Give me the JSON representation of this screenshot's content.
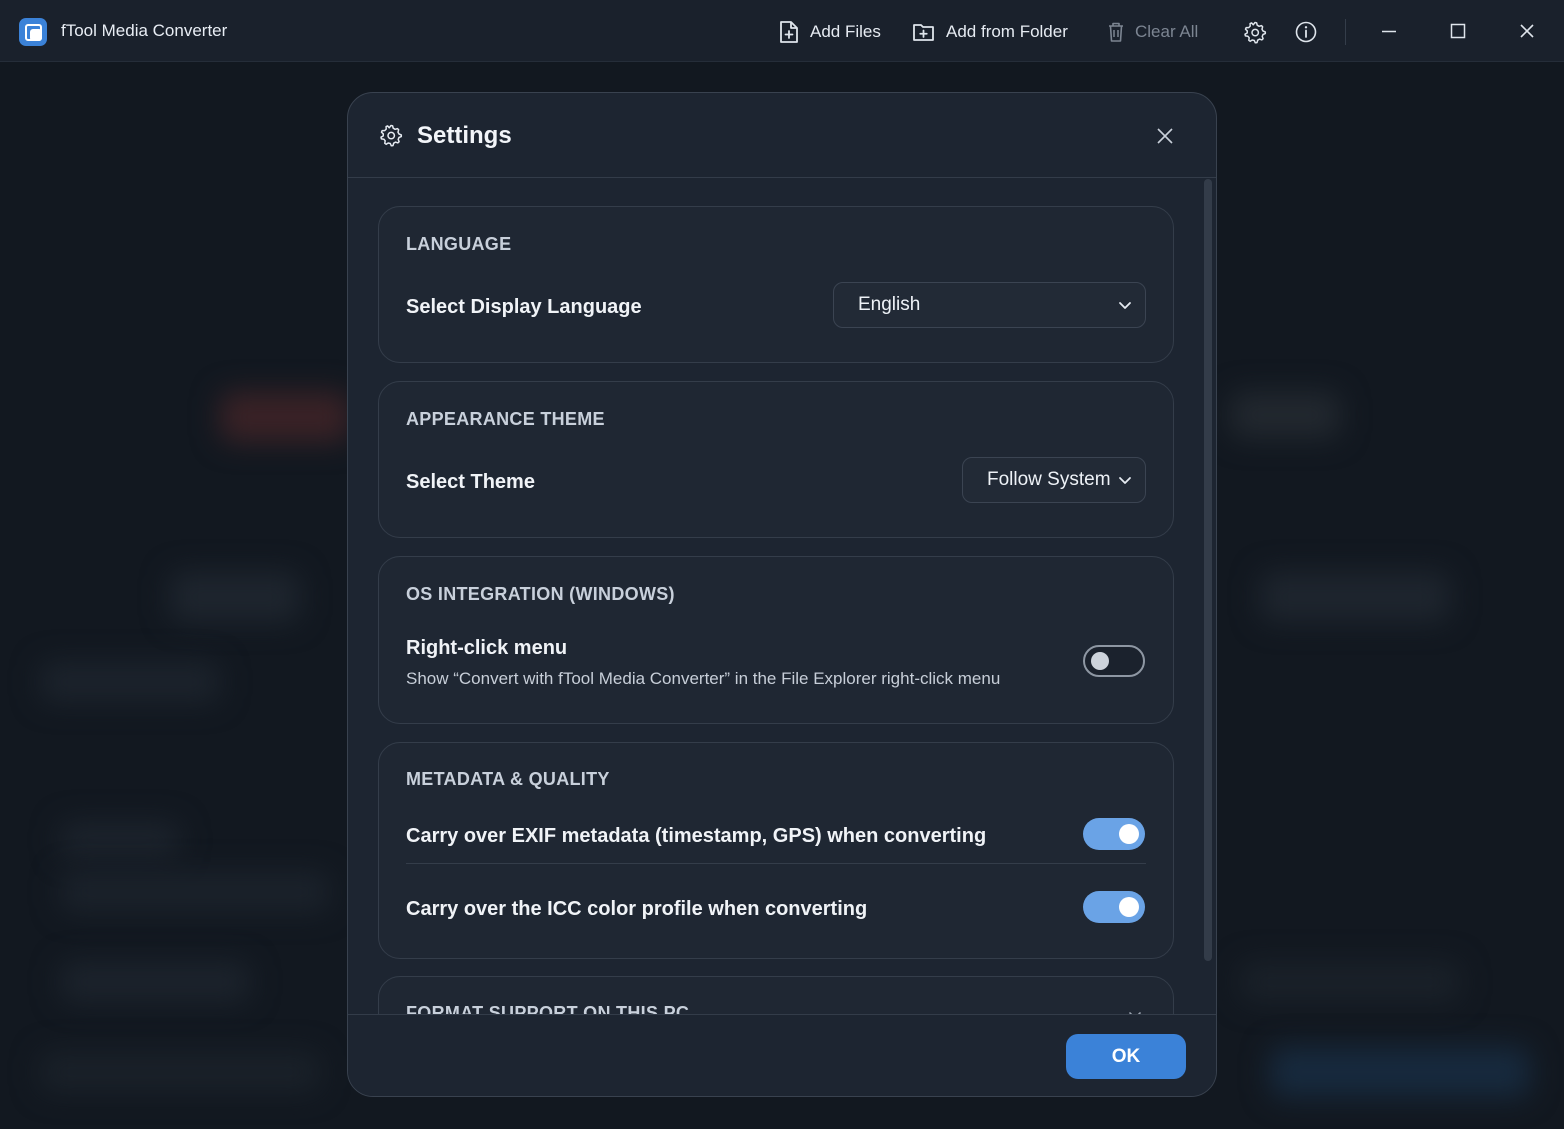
{
  "app": {
    "title": "fTool Media Converter"
  },
  "toolbar": {
    "add_files": "Add Files",
    "add_from_folder": "Add from Folder",
    "clear_all": "Clear All"
  },
  "dialog": {
    "title": "Settings",
    "sections": {
      "language": {
        "title": "LANGUAGE",
        "label": "Select Display Language",
        "value": "English"
      },
      "appearance": {
        "title": "APPEARANCE THEME",
        "label": "Select Theme",
        "value": "Follow System"
      },
      "os": {
        "title": "OS INTEGRATION (WINDOWS)",
        "label": "Right-click menu",
        "description": "Show “Convert with fTool Media Converter” in the File Explorer right-click menu",
        "enabled": false
      },
      "metadata": {
        "title": "METADATA & QUALITY",
        "exif_label": "Carry over EXIF metadata (timestamp, GPS) when converting",
        "exif_enabled": true,
        "icc_label": "Carry over the ICC color profile when converting",
        "icc_enabled": true
      },
      "format": {
        "title": "FORMAT SUPPORT ON THIS PC"
      }
    },
    "ok_label": "OK"
  },
  "colors": {
    "accent": "#3b82d8",
    "toggle_on": "#6aa3e6",
    "dialog_bg": "#1d2531"
  }
}
